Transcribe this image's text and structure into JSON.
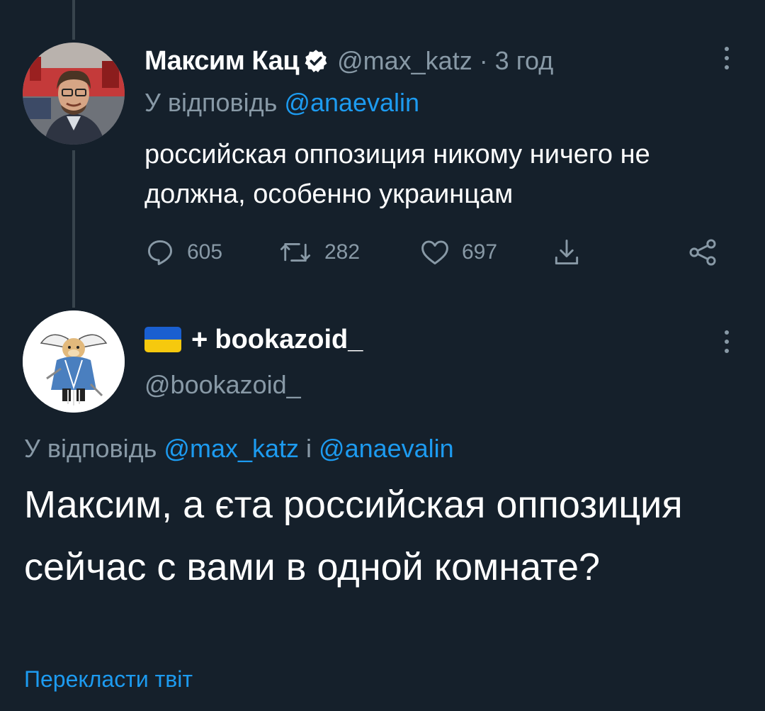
{
  "tweet1": {
    "display_name": "Максим Кац",
    "handle_time": "@max_katz · 3 год",
    "reply_prefix": "У відповідь ",
    "reply_mention": "@anaevalin",
    "text": "российская оппозиция никому ничего не должна, особенно украинцам",
    "stats": {
      "replies": "605",
      "retweets": "282",
      "likes": "697"
    },
    "icons": [
      "verified-badge-icon",
      "reply-icon",
      "retweet-icon",
      "like-icon",
      "share-icon",
      "send-icon",
      "more-icon"
    ]
  },
  "tweet2": {
    "plus": "+",
    "display_name": "bookazoid_",
    "handle": "@bookazoid_",
    "reply_prefix": "У відповідь ",
    "reply_mention_1": "@max_katz",
    "reply_conjunction": " і ",
    "reply_mention_2": "@anaevalin",
    "text": "Максим, а єта российская оппозиция сейчас с вами в одной комнате?",
    "translate_link": "Перекласти твіт",
    "flag_colors": [
      "#1a5fd0",
      "#f6c90e"
    ]
  },
  "colors": {
    "background": "#15202b",
    "secondary_text": "#8899a6",
    "accent": "#1d9bf0",
    "thread_line": "#38444d"
  }
}
